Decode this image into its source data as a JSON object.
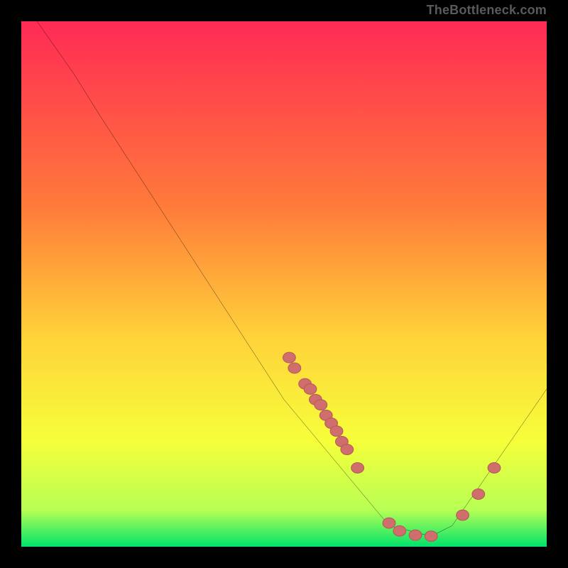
{
  "watermark": "TheBottleneck.com",
  "colors": {
    "line": "#000000",
    "marker_fill": "#cf6e6c",
    "marker_stroke": "#b55c5a",
    "gradient_top": "#ff2a55",
    "gradient_mid1": "#ff7a3a",
    "gradient_mid2": "#ffd23a",
    "gradient_mid3": "#f6ff3a",
    "gradient_low1": "#b7ff55",
    "gradient_bottom": "#00e36a"
  },
  "chart_data": {
    "type": "line",
    "title": "",
    "xlabel": "",
    "ylabel": "",
    "xlim": [
      0,
      100
    ],
    "ylim": [
      0,
      100
    ],
    "grid": false,
    "line": [
      {
        "x": 3,
        "y": 100
      },
      {
        "x": 10,
        "y": 90
      },
      {
        "x": 15,
        "y": 82
      },
      {
        "x": 50,
        "y": 28
      },
      {
        "x": 70,
        "y": 4
      },
      {
        "x": 78,
        "y": 2
      },
      {
        "x": 82,
        "y": 4
      },
      {
        "x": 100,
        "y": 30
      }
    ],
    "markers": [
      {
        "x": 51,
        "y": 36
      },
      {
        "x": 52,
        "y": 34
      },
      {
        "x": 54,
        "y": 31
      },
      {
        "x": 55,
        "y": 30
      },
      {
        "x": 56,
        "y": 28
      },
      {
        "x": 57,
        "y": 27
      },
      {
        "x": 58,
        "y": 25
      },
      {
        "x": 59,
        "y": 23.5
      },
      {
        "x": 60,
        "y": 22
      },
      {
        "x": 61,
        "y": 20
      },
      {
        "x": 62,
        "y": 18.5
      },
      {
        "x": 64,
        "y": 15
      },
      {
        "x": 70,
        "y": 4.5
      },
      {
        "x": 72,
        "y": 3
      },
      {
        "x": 75,
        "y": 2.2
      },
      {
        "x": 78,
        "y": 2
      },
      {
        "x": 84,
        "y": 6
      },
      {
        "x": 87,
        "y": 10
      },
      {
        "x": 90,
        "y": 15
      }
    ],
    "note": "Axes are unlabeled in the source image; x and y are normalized 0–100. The curve depicts a bottleneck-style valley with minimum near x≈78, y≈2."
  }
}
